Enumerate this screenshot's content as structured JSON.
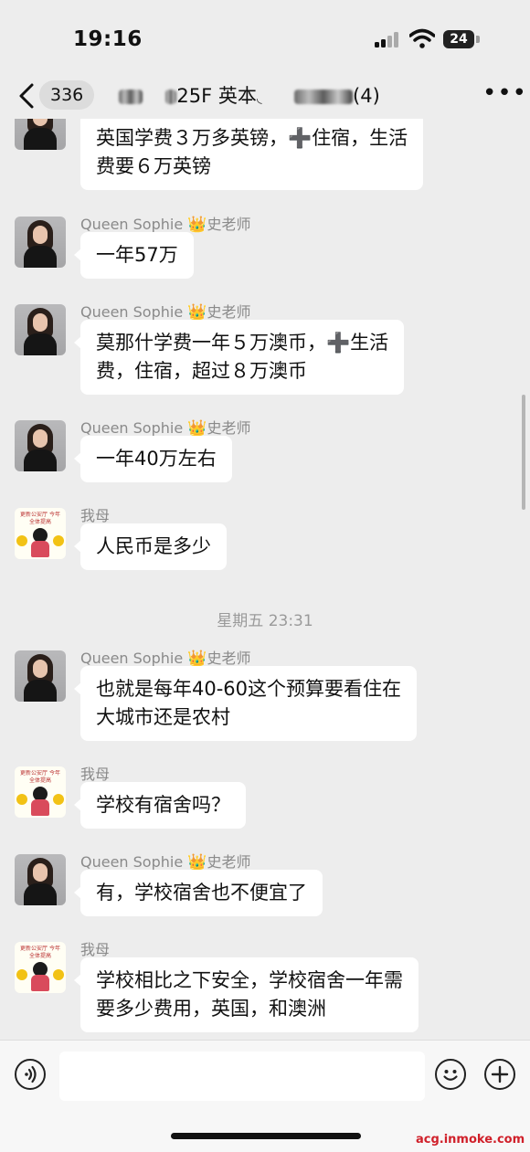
{
  "status_bar": {
    "time": "19:16",
    "battery": "24"
  },
  "nav": {
    "unread_count": "336",
    "title_text": "25F 英本",
    "member_count": "(4)",
    "more_glyph": "•••"
  },
  "messages": [
    {
      "sender_name": "",
      "text_lines": [
        "英国学费３万多英镑，➕住宿，生活",
        "费要６万英镑"
      ]
    },
    {
      "sender_name": "Queen Sophie",
      "sender_suffix": "史老师",
      "crown": "👑",
      "text_lines": [
        "一年57万"
      ]
    },
    {
      "sender_name": "Queen Sophie",
      "sender_suffix": "史老师",
      "crown": "👑",
      "text_lines": [
        "莫那什学费一年５万澳币，➕生活",
        "费，住宿，超过８万澳币"
      ]
    },
    {
      "sender_name": "Queen Sophie",
      "sender_suffix": "史老师",
      "crown": "👑",
      "text_lines": [
        "一年40万左右"
      ]
    },
    {
      "sender_name": "我母",
      "text_lines": [
        "人民币是多少"
      ]
    },
    {
      "timestamp": "星期五 23:31"
    },
    {
      "sender_name": "Queen Sophie",
      "sender_suffix": "史老师",
      "crown": "👑",
      "text_lines": [
        "也就是每年40-60这个预算要看住在",
        "大城市还是农村"
      ]
    },
    {
      "sender_name": "我母",
      "text_lines": [
        "学校有宿舍吗？"
      ]
    },
    {
      "sender_name": "Queen Sophie",
      "sender_suffix": "史老师",
      "crown": "👑",
      "text_lines": [
        "有，学校宿舍也不便宜了"
      ]
    },
    {
      "sender_name": "我母",
      "text_lines": [
        "学校相比之下安全，学校宿舍一年需",
        "要多少费用，英国，和澳洲"
      ]
    }
  ],
  "avatar_mom_caption": "更新公安厅 今年全体提高",
  "watermark": "acg.inmoke.com",
  "icons": [
    "back-chevron",
    "more-dots",
    "voice",
    "emoji",
    "plus"
  ]
}
